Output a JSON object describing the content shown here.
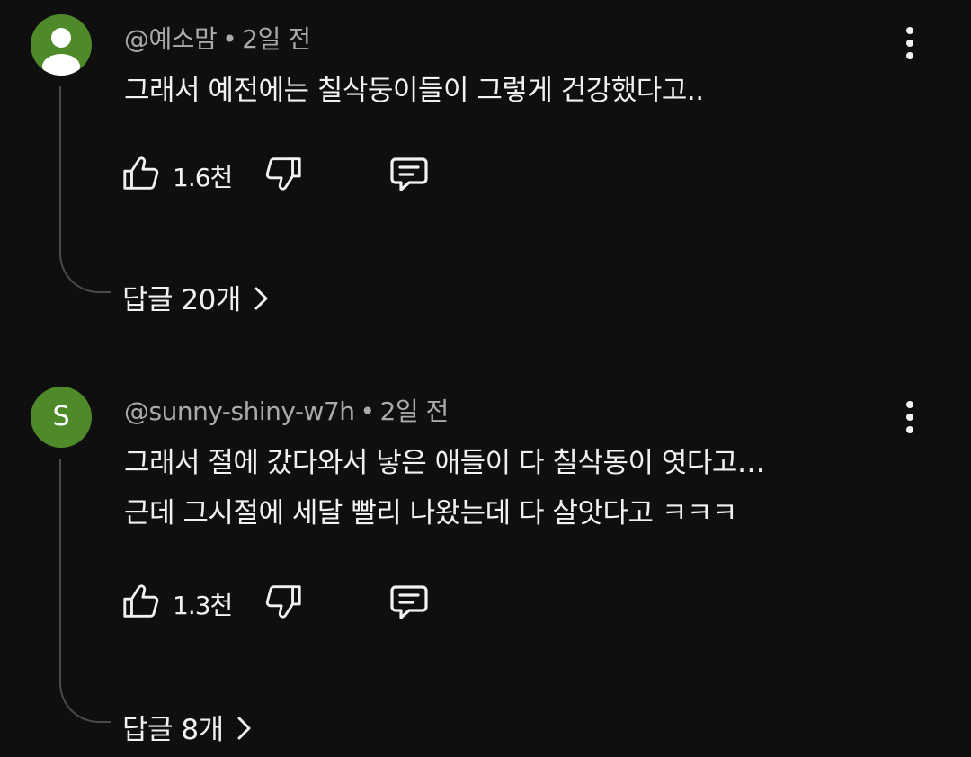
{
  "comments": [
    {
      "author": "@예소맘",
      "time": "2일 전",
      "avatar_letter": "",
      "avatar_type": "default-person-icon",
      "lines": [
        "그래서 예전에는 칠삭둥이들이 그렇게 건강했다고.."
      ],
      "likes": "1.6천",
      "replies_label": "답글 20개"
    },
    {
      "author": "@sunny-shiny-w7h",
      "time": "2일 전",
      "avatar_letter": "S",
      "avatar_type": "letter",
      "lines": [
        "그래서 절에 갔다와서 낳은 애들이 다 칠삭동이 엿다고…",
        "근데 그시절에 세달 빨리 나왔는데 다 살앗다고 ㅋㅋㅋ"
      ],
      "likes": "1.3천",
      "replies_label": "답글 8개"
    }
  ],
  "ui": {
    "separator": "•",
    "avatar_color": "#4e8a2a",
    "background_color": "#0f0f0f",
    "icons": {
      "like": "thumbs-up-icon",
      "dislike": "thumbs-down-icon",
      "reply": "comment-icon",
      "more": "more-vert-icon",
      "chevron": "chevron-right-icon"
    }
  }
}
